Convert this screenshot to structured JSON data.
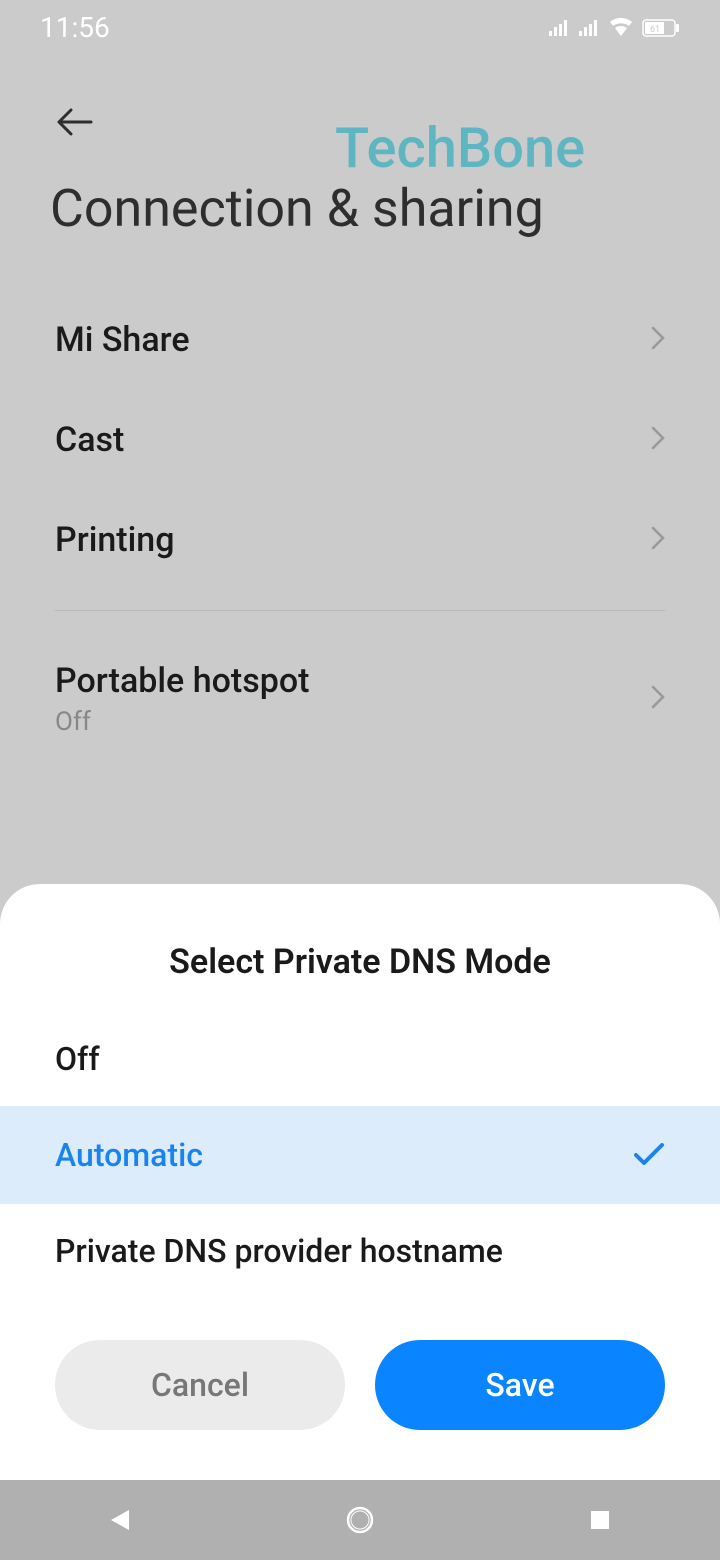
{
  "status": {
    "time": "11:56",
    "battery": "61"
  },
  "watermark": "TechBone",
  "page": {
    "title": "Connection & sharing"
  },
  "settings": {
    "mi_share": "Mi Share",
    "cast": "Cast",
    "printing": "Printing",
    "hotspot": {
      "label": "Portable hotspot",
      "status": "Off"
    }
  },
  "sheet": {
    "title": "Select Private DNS Mode",
    "options": {
      "off": "Off",
      "automatic": "Automatic",
      "hostname": "Private DNS provider hostname"
    },
    "cancel": "Cancel",
    "save": "Save"
  }
}
